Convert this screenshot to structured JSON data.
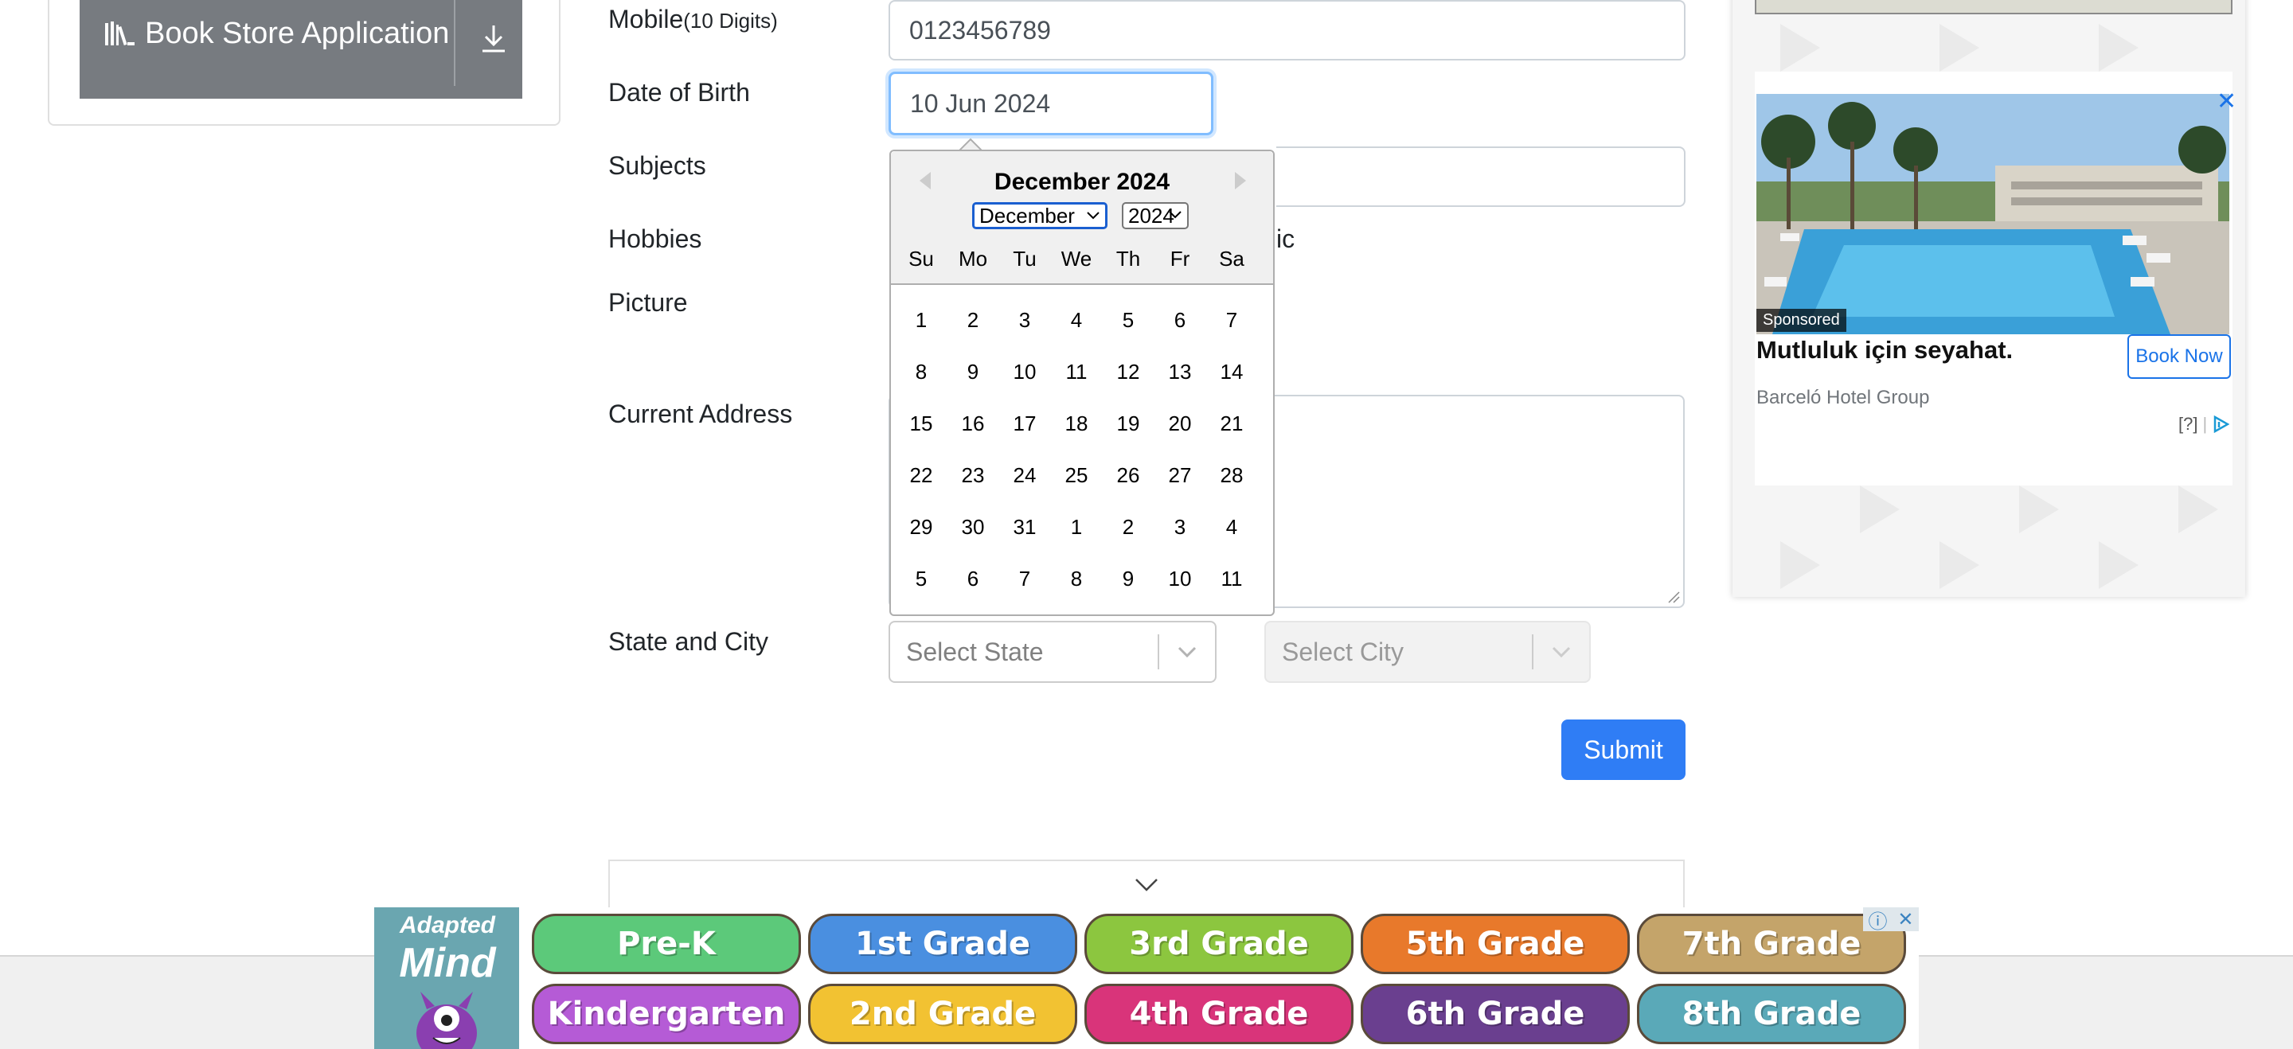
{
  "sidebar": {
    "book_store_label": "Book Store Application"
  },
  "form": {
    "mobile_label": "Mobile",
    "mobile_hint": "(10 Digits)",
    "mobile_value": "0123456789",
    "dob_label": "Date of Birth",
    "dob_value": "10 Jun 2024",
    "subjects_label": "Subjects",
    "hobbies_label": "Hobbies",
    "hobbies_tail": "ic",
    "picture_label": "Picture",
    "address_label": "Current Address",
    "state_city_label": "State and City",
    "state_placeholder": "Select State",
    "city_placeholder": "Select City",
    "submit_label": "Submit"
  },
  "datepicker": {
    "title": "December 2024",
    "month_select": "December",
    "year_select": "2024",
    "weekdays": [
      "Su",
      "Mo",
      "Tu",
      "We",
      "Th",
      "Fr",
      "Sa"
    ],
    "weeks": [
      [
        "1",
        "2",
        "3",
        "4",
        "5",
        "6",
        "7"
      ],
      [
        "8",
        "9",
        "10",
        "11",
        "12",
        "13",
        "14"
      ],
      [
        "15",
        "16",
        "17",
        "18",
        "19",
        "20",
        "21"
      ],
      [
        "22",
        "23",
        "24",
        "25",
        "26",
        "27",
        "28"
      ],
      [
        "29",
        "30",
        "31",
        "1",
        "2",
        "3",
        "4"
      ],
      [
        "5",
        "6",
        "7",
        "8",
        "9",
        "10",
        "11"
      ]
    ]
  },
  "right_ad": {
    "sponsored": "Sponsored",
    "headline": "Mutluluk için seyahat.",
    "cta": "Book Now",
    "brand": "Barceló Hotel Group",
    "info": "[?]"
  },
  "bottom_ad": {
    "logo_line1": "Adapted",
    "logo_line2": "Mind",
    "grades": [
      {
        "label": "Pre-K",
        "color": "#5cc97a"
      },
      {
        "label": "1st Grade",
        "color": "#4a8fe0"
      },
      {
        "label": "3rd Grade",
        "color": "#8cc63f"
      },
      {
        "label": "5th Grade",
        "color": "#e8792b"
      },
      {
        "label": "7th Grade",
        "color": "#c4a46a"
      },
      {
        "label": "Kindergarten",
        "color": "#b55bd6"
      },
      {
        "label": "2nd Grade",
        "color": "#f2c232"
      },
      {
        "label": "4th Grade",
        "color": "#d9347a"
      },
      {
        "label": "6th Grade",
        "color": "#6a3f8f"
      },
      {
        "label": "8th Grade",
        "color": "#5aa9b8"
      }
    ]
  },
  "colors": {
    "primary": "#2f7df5",
    "sidebar_item": "#777b80",
    "focus": "#80bdff"
  }
}
